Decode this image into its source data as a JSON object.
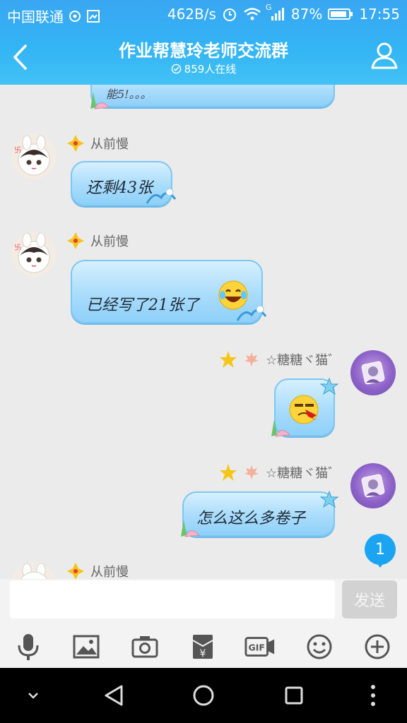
{
  "status_bar": {
    "carrier": "中国联通",
    "net_speed": "462B/s",
    "signal_label": "G",
    "battery": "87%",
    "time": "17:55"
  },
  "header": {
    "title": "作业帮慧玲老师交流群",
    "online": "859人在线"
  },
  "messages": [
    {
      "sender": "",
      "text": "能5!。。。",
      "side": "right-partial"
    },
    {
      "sender": "从前慢",
      "text": "还剩43张",
      "side": "left"
    },
    {
      "sender": "从前慢",
      "text": "已经写了21张了",
      "emoji": "tears-of-joy",
      "side": "left"
    },
    {
      "sender": "☆糖糖ヾ猫゛",
      "text": "",
      "emoji": "bloody-face",
      "side": "right"
    },
    {
      "sender": "☆糖糖ヾ猫゛",
      "text": "怎么这么多卷子",
      "side": "right"
    },
    {
      "sender": "从前慢",
      "text": "",
      "side": "left-partial"
    }
  ],
  "unread_count": "1",
  "input": {
    "value": "",
    "send_label": "发送"
  },
  "toolbar": [
    "mic-icon",
    "image-icon",
    "camera-icon",
    "red-packet-icon",
    "gif-icon",
    "emoji-icon",
    "plus-icon"
  ],
  "nav": [
    "collapse-icon",
    "back-icon",
    "home-icon",
    "recents-icon",
    "more-icon"
  ],
  "colors": {
    "accent": "#33b4f4",
    "bubble": "#a9dcfb",
    "badge": "#1aa4f2"
  }
}
